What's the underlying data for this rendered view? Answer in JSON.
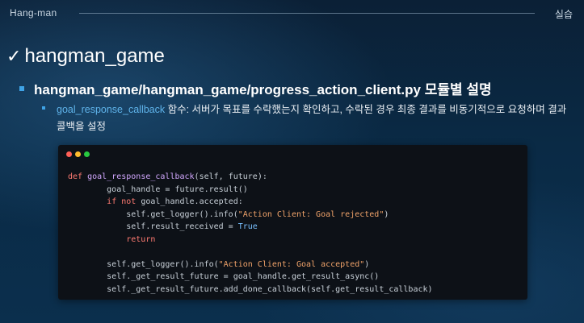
{
  "header": {
    "left_title": "Hang-man",
    "right_label": "실습"
  },
  "slide": {
    "title": "hangman_game",
    "subtitle": "hangman_game/hangman_game/progress_action_client.py 모듈별 설명",
    "desc_fn": "goal_response_callback",
    "desc_text": " 함수: 서버가 목표를 수락했는지 확인하고, 수락된 경우 최종 결과를 비동기적으로 요청하며 결과 콜백을 설정"
  },
  "code_lines": [
    "def goal_response_callback(self, future):",
    "        goal_handle = future.result()",
    "        if not goal_handle.accepted:",
    "            self.get_logger().info(\"Action Client: Goal rejected\")",
    "            self.result_received = True",
    "            return",
    "",
    "        self.get_logger().info(\"Action Client: Goal accepted\")",
    "        self._get_result_future = goal_handle.get_result_async()",
    "        self._get_result_future.add_done_callback(self.get_result_callback)"
  ]
}
